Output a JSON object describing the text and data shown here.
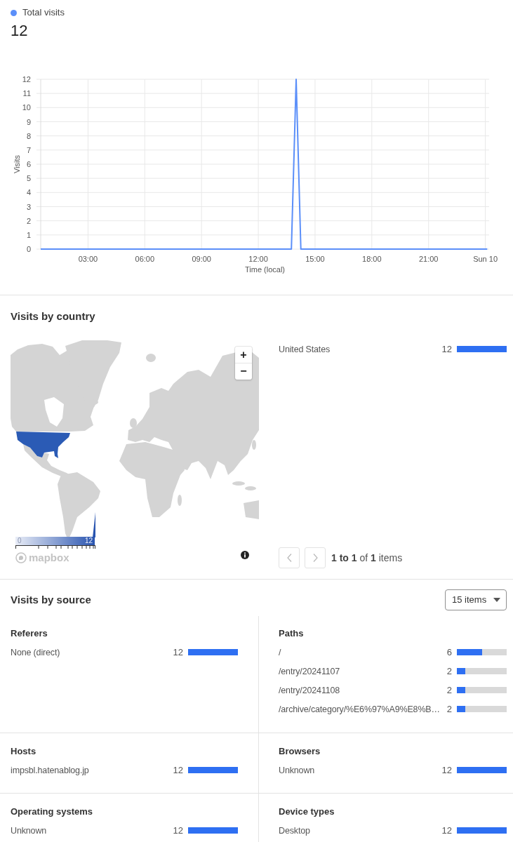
{
  "visits_summary": {
    "value": "12",
    "chart_data": {
      "type": "line",
      "xlabel": "Time (local)",
      "ylabel": "Visits",
      "x": [
        0.5,
        13.75,
        14,
        14.25,
        24.1
      ],
      "series": [
        {
          "name": "Total visits",
          "color": "#5b8ff9",
          "values": [
            0,
            0,
            12,
            0,
            0
          ]
        }
      ],
      "xlim": [
        0.5,
        24.2
      ],
      "ylim": [
        0,
        12
      ],
      "grid": true,
      "xticks": [
        {
          "value": 3,
          "label": "03:00"
        },
        {
          "value": 6,
          "label": "06:00"
        },
        {
          "value": 9,
          "label": "09:00"
        },
        {
          "value": 12,
          "label": "12:00"
        },
        {
          "value": 15,
          "label": "15:00"
        },
        {
          "value": 18,
          "label": "18:00"
        },
        {
          "value": 21,
          "label": "21:00"
        },
        {
          "value": 24,
          "label": "Sun 10"
        }
      ],
      "yticks": [
        0,
        1,
        2,
        3,
        4,
        5,
        6,
        7,
        8,
        9,
        10,
        11,
        12
      ]
    }
  },
  "visits_by_country": {
    "title": "Visits by country",
    "map": {
      "zoom_in": "+",
      "zoom_out": "−",
      "scale_min": "0",
      "scale_max": "12",
      "logo_text": "mapbox"
    },
    "items": [
      {
        "label": "United States",
        "value": "12",
        "level": 1
      }
    ],
    "pagination": {
      "text": "**1 to 1** of **1** items",
      "previous": {
        "disabled": true
      },
      "next": {
        "disabled": true
      }
    }
  },
  "visits_by_source": {
    "title": "Visits by source",
    "page_size": "15 items",
    "panels": [
      {
        "title": "Referers",
        "items": [
          {
            "label": "None (direct)",
            "value": "12",
            "level": 1
          }
        ]
      },
      {
        "title": "Paths",
        "items": [
          {
            "label": "/",
            "value": "6",
            "level": 0.5
          },
          {
            "label": "/entry/20241107",
            "value": "2",
            "level": 0.17
          },
          {
            "label": "/entry/20241108",
            "value": "2",
            "level": 0.17
          },
          {
            "label": "/archive/category/%E6%97%A9%E8%B…",
            "value": "2",
            "level": 0.17
          }
        ]
      },
      {
        "title": "Hosts",
        "items": [
          {
            "label": "impsbl.hatenablog.jp",
            "value": "12",
            "level": 1
          }
        ]
      },
      {
        "title": "Browsers",
        "items": [
          {
            "label": "Unknown",
            "value": "12",
            "level": 1
          }
        ]
      },
      {
        "title": "Operating systems",
        "items": [
          {
            "label": "Unknown",
            "value": "12",
            "level": 1
          }
        ]
      },
      {
        "title": "Device types",
        "items": [
          {
            "label": "Desktop",
            "value": "12",
            "level": 1
          }
        ]
      }
    ]
  }
}
